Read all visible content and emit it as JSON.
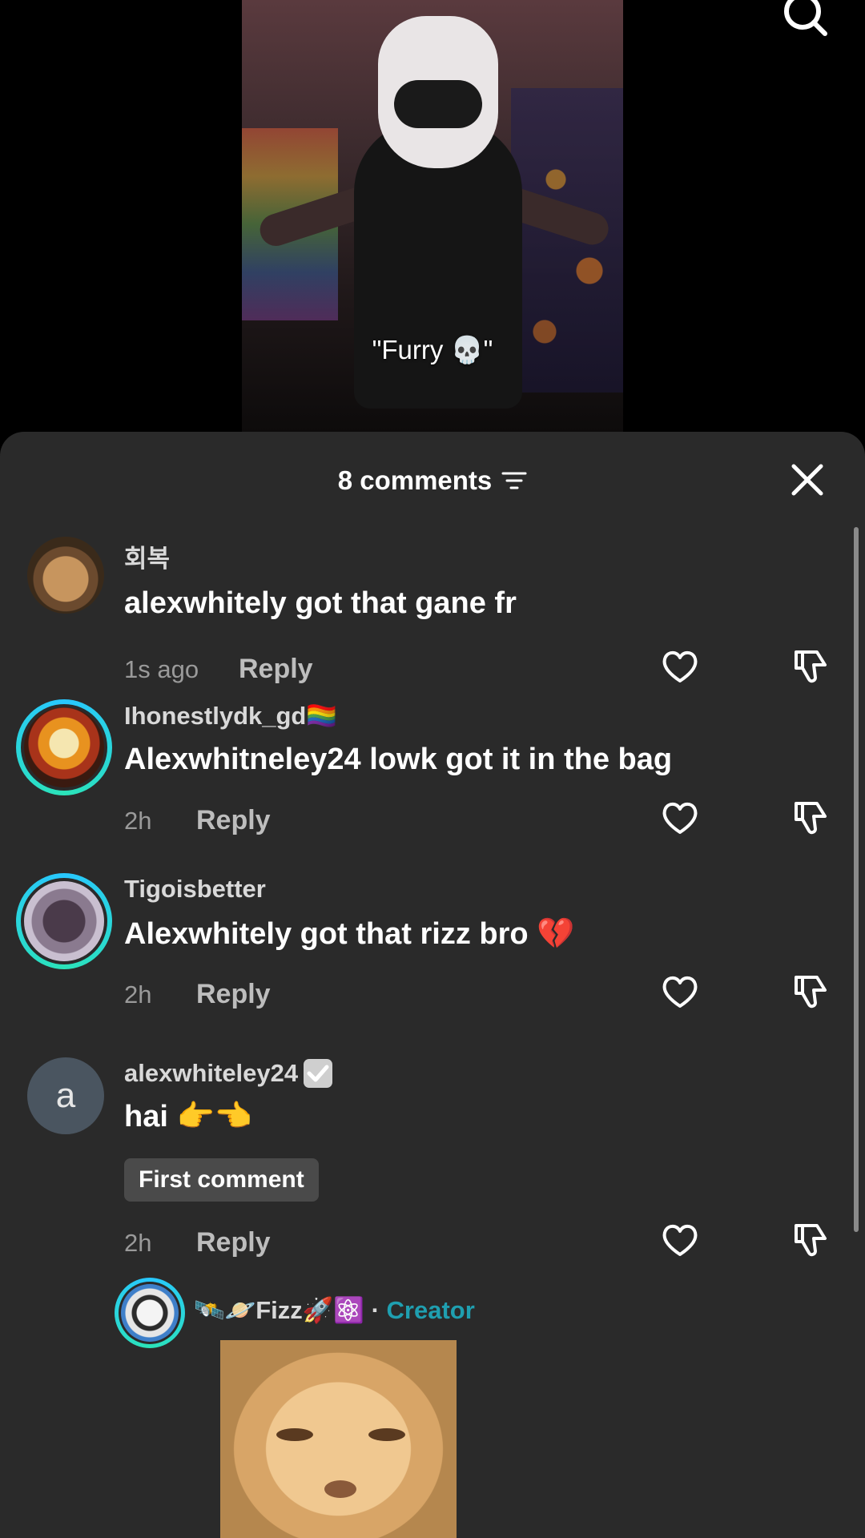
{
  "video": {
    "caption": "\"Furry 💀\""
  },
  "comments_panel": {
    "title": "8 comments",
    "comments": [
      {
        "username": "회복",
        "text": "alexwhitely got that gane fr",
        "time": "1s ago",
        "reply_label": "Reply"
      },
      {
        "username": "Ihonestlydk_gd🏳️‍🌈",
        "text": "Alexwhitneley24 lowk got it in the bag",
        "time": "2h",
        "reply_label": "Reply"
      },
      {
        "username": "Tigoisbetter",
        "text": "Alexwhitely got that rizz bro 💔",
        "time": "2h",
        "reply_label": "Reply"
      },
      {
        "username": "alexwhiteley24",
        "avatar_letter": "a",
        "text": "hai 👉👈",
        "badge": "First comment",
        "time": "2h",
        "reply_label": "Reply"
      },
      {
        "username": "🛰️🪐Fizz🚀⚛️",
        "separator": " · ",
        "role": "Creator"
      }
    ]
  },
  "icons": {
    "search": "search-icon",
    "filter": "filter-icon",
    "close": "close-icon",
    "like": "heart-icon",
    "dislike": "thumbs-down-icon",
    "verified": "verified-check-icon"
  },
  "colors": {
    "sheet_bg": "#2a2a2a",
    "creator": "#1f9fb0",
    "ring": "#28c7ff"
  }
}
